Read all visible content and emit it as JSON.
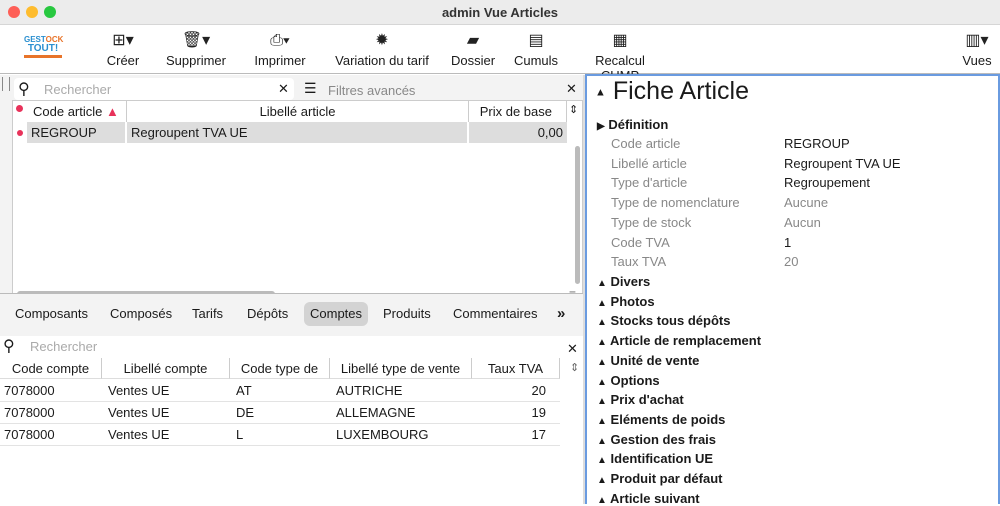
{
  "window": {
    "title": "admin Vue Articles"
  },
  "toolbar": {
    "items": [
      {
        "label": "Créer",
        "icon": "add-square-icon"
      },
      {
        "label": "Supprimer",
        "icon": "trash-icon"
      },
      {
        "label": "Imprimer",
        "icon": "printer-icon"
      },
      {
        "label": "Variation du tarif",
        "icon": "percent-badge-icon"
      },
      {
        "label": "Dossier",
        "icon": "folder-icon"
      },
      {
        "label": "Cumuls",
        "icon": "document-chart-icon"
      },
      {
        "label": "Recalcul CUMP",
        "icon": "calculator-icon"
      }
    ],
    "views": "Vues",
    "logo": "GESTOCK TOUT!"
  },
  "articles": {
    "search_placeholder": "Rechercher",
    "filters": "Filtres avancés",
    "columns": [
      "Code article",
      "Libellé article",
      "Prix de base"
    ],
    "rows": [
      {
        "code": "REGROUP",
        "label": "Regroupent TVA UE",
        "price": "0,00"
      }
    ]
  },
  "tabs": {
    "items": [
      "Composants",
      "Composés",
      "Tarifs",
      "Dépôts",
      "Comptes",
      "Produits",
      "Commentaires"
    ],
    "active": "Comptes",
    "more": "»"
  },
  "accounts": {
    "search_placeholder": "Rechercher",
    "columns": [
      "Code compte",
      "Libellé compte",
      "Code type de",
      "Libellé type de vente",
      "Taux TVA"
    ],
    "rows": [
      [
        "7078000",
        "Ventes UE",
        "AT",
        "AUTRICHE",
        "20"
      ],
      [
        "7078000",
        "Ventes UE",
        "DE",
        "ALLEMAGNE",
        "19"
      ],
      [
        "7078000",
        "Ventes UE",
        "L",
        "LUXEMBOURG",
        "17"
      ]
    ]
  },
  "fiche": {
    "title": "Fiche Article",
    "definition": "Définition",
    "fields": [
      {
        "label": "Code article",
        "value": "REGROUP",
        "muted": false
      },
      {
        "label": "Libellé article",
        "value": "Regroupent TVA UE",
        "muted": false
      },
      {
        "label": "Type d'article",
        "value": "Regroupement",
        "muted": false
      },
      {
        "label": "Type de nomenclature",
        "value": "Aucune",
        "muted": true
      },
      {
        "label": "Type de stock",
        "value": "Aucun",
        "muted": true
      },
      {
        "label": "Code TVA",
        "value": "1",
        "muted": false
      },
      {
        "label": "Taux TVA",
        "value": "20",
        "muted": true
      }
    ],
    "sections": [
      "Divers",
      "Photos",
      "Stocks tous dépôts",
      "Article de remplacement",
      "Unité de vente",
      "Options",
      "Prix d'achat",
      "Eléments de poids",
      "Gestion des frais",
      "Identification UE",
      "Produit par défaut",
      "Article suivant"
    ]
  }
}
